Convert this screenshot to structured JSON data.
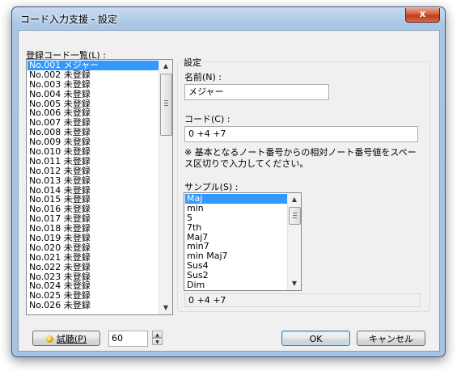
{
  "window": {
    "title": "コード入力支援 - 設定",
    "close_glyph": "x"
  },
  "left": {
    "list_label": "登録コード一覧(L) :",
    "items": [
      "No.001 メジャー",
      "No.002 未登録",
      "No.003 未登録",
      "No.004 未登録",
      "No.005 未登録",
      "No.006 未登録",
      "No.007 未登録",
      "No.008 未登録",
      "No.009 未登録",
      "No.010 未登録",
      "No.011 未登録",
      "No.012 未登録",
      "No.013 未登録",
      "No.014 未登録",
      "No.015 未登録",
      "No.016 未登録",
      "No.017 未登録",
      "No.018 未登録",
      "No.019 未登録",
      "No.020 未登録",
      "No.021 未登録",
      "No.022 未登録",
      "No.023 未登録",
      "No.024 未登録",
      "No.025 未登録",
      "No.026 未登録"
    ],
    "selected_index": 0
  },
  "settings": {
    "group_title": "設定",
    "name_label": "名前(N) :",
    "name_value": "メジャー",
    "code_label": "コード(C) :",
    "code_value": "0 +4 +7",
    "note": "※ 基本となるノート番号からの相対ノート番号値をスペース区切りで入力してください。",
    "sample_label": "サンプル(S) :",
    "samples": [
      "Maj",
      "min",
      "5",
      "7th",
      "Maj7",
      "min7",
      "min Maj7",
      "Sus4",
      "Sus2",
      "Dim"
    ],
    "selected_sample_index": 0,
    "sample_result": "0 +4 +7"
  },
  "footer": {
    "preview_label": "試聴(P)",
    "preview_icon": "speaker-icon",
    "spin_value": "60",
    "ok_label": "OK",
    "cancel_label": "キャンセル"
  },
  "colors": {
    "selection": "#3399ff",
    "dialog_bg": "#f0f0f0",
    "frame": "#a9c6e6",
    "close": "#c7432a"
  }
}
